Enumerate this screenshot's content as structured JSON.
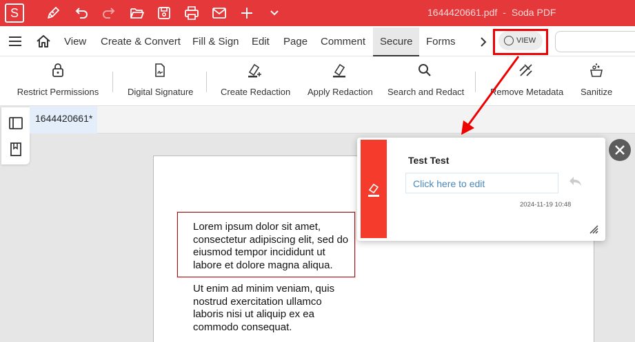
{
  "app": {
    "logo_letter": "S",
    "file_name": "1644420661.pdf",
    "separator": "-",
    "app_name": "Soda PDF"
  },
  "quick_access": [
    "pen-icon",
    "undo-icon",
    "redo-icon",
    "open-folder-icon",
    "save-icon",
    "print-icon",
    "mail-icon",
    "plus-icon",
    "chevron-down-icon"
  ],
  "menu": {
    "items": [
      "View",
      "Create & Convert",
      "Fill & Sign",
      "Edit",
      "Page",
      "Comment",
      "Secure",
      "Forms"
    ],
    "active": "Secure",
    "more_icon": "chevron-right-icon",
    "view_toggle": "VIEW"
  },
  "ribbon": {
    "buttons": [
      {
        "label": "Restrict Permissions",
        "icon": "lock-icon"
      },
      {
        "label": "Digital Signature",
        "icon": "signature-icon"
      },
      {
        "label": "Create Redaction",
        "icon": "create-redaction-icon"
      },
      {
        "label": "Apply Redaction",
        "icon": "apply-redaction-icon"
      },
      {
        "label": "Search and Redact",
        "icon": "search-icon"
      },
      {
        "label": "Remove Metadata",
        "icon": "remove-metadata-icon"
      },
      {
        "label": "Sanitize",
        "icon": "sanitize-icon"
      }
    ]
  },
  "tabs": {
    "document": "1644420661*"
  },
  "document": {
    "paragraph1": "Lorem ipsum dolor sit amet, consectetur adipiscing elit, sed do eiusmod tempor incididunt ut labore et dolore magna aliqua.",
    "paragraph2": "Ut enim ad minim veniam, quis nostrud exercitation ullamco laboris nisi ut aliquip ex ea commodo consequat."
  },
  "comment": {
    "author": "Test Test",
    "placeholder": "Click here to edit",
    "date": "2024-11-19 10:48"
  },
  "colors": {
    "brand": "#e5383b",
    "redaction": "#f53b2b",
    "highlight": "#ee0000"
  }
}
